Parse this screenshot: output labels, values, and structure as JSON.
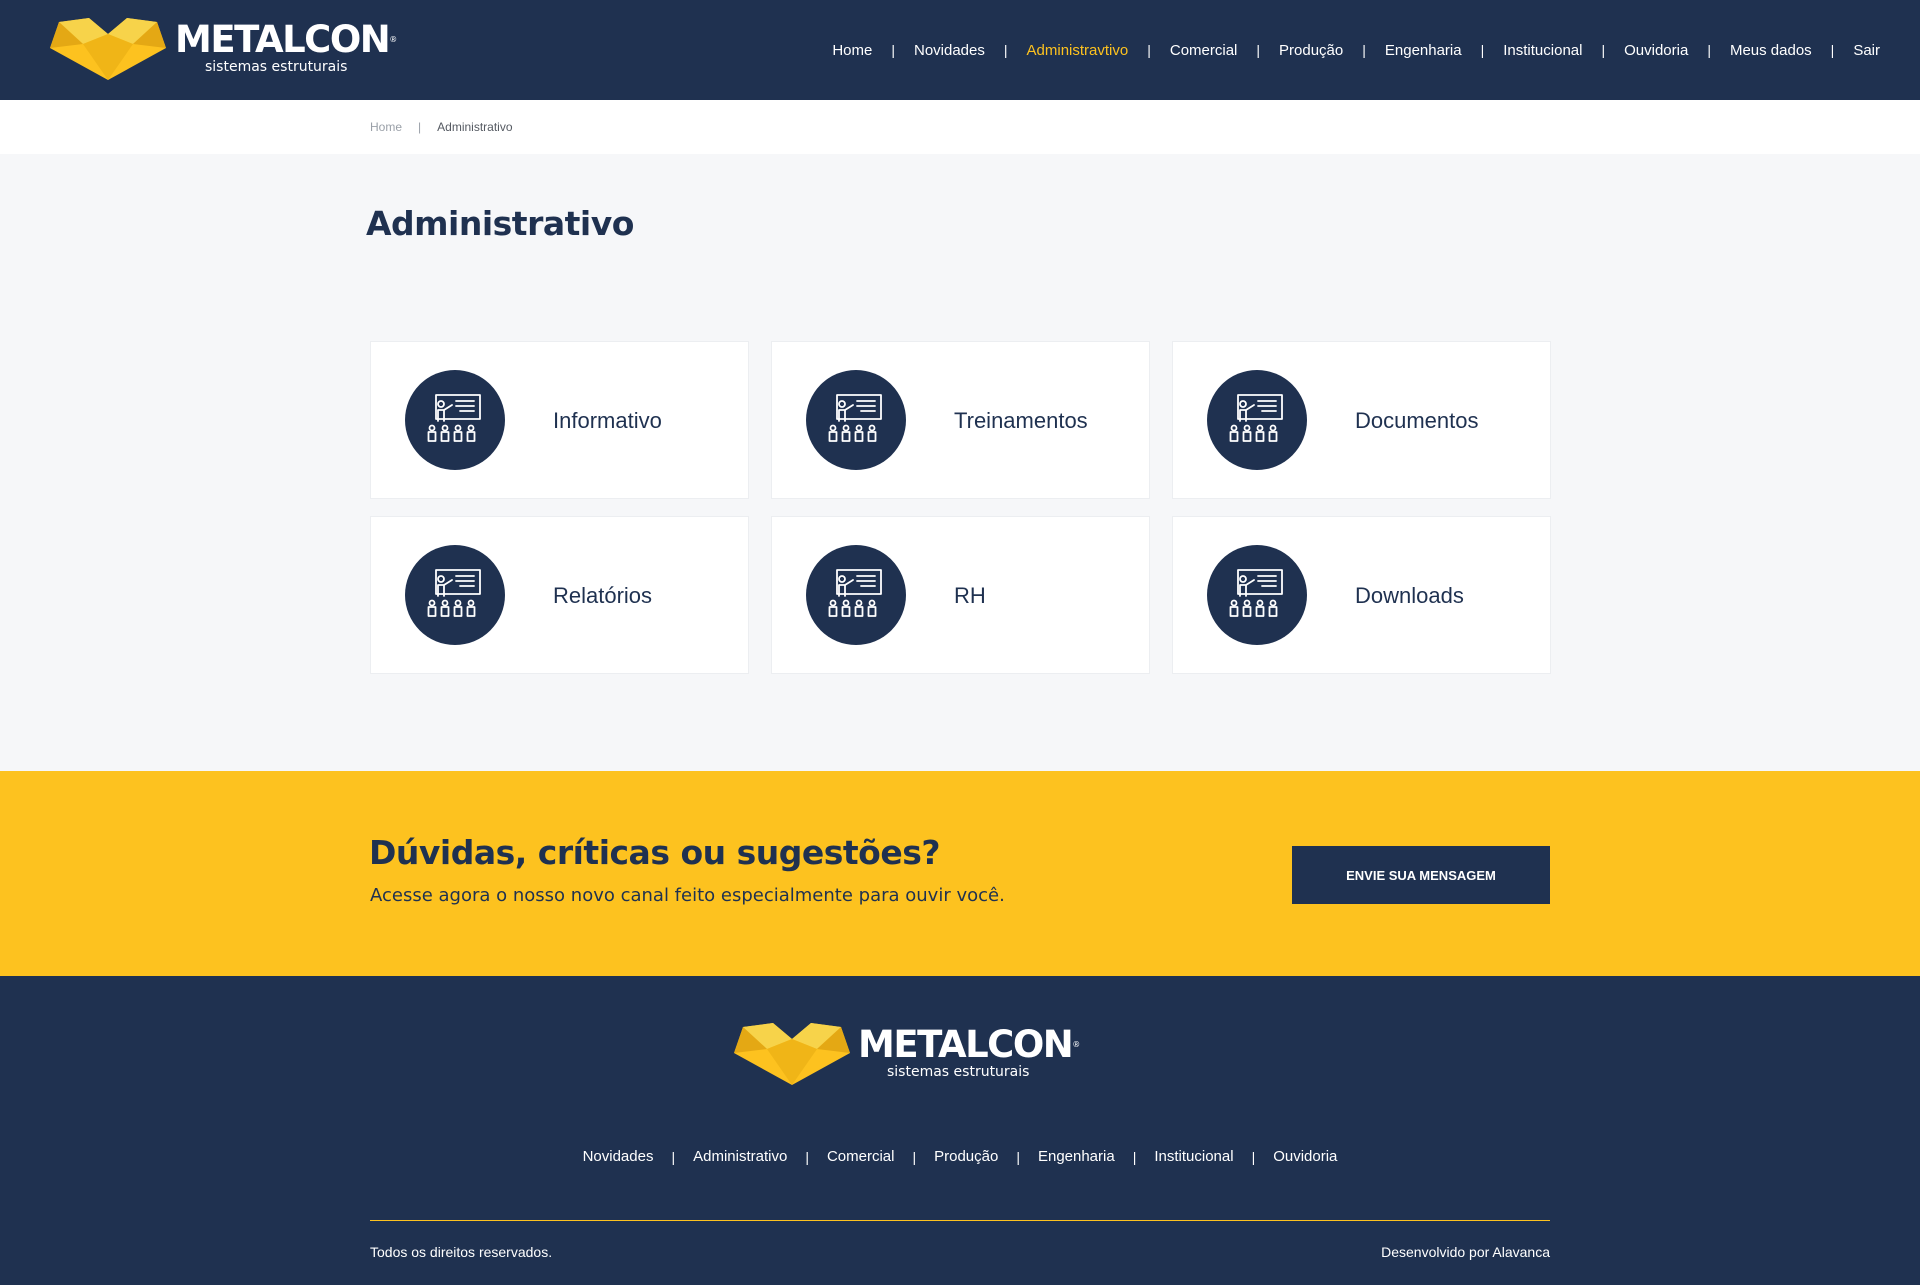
{
  "brand": {
    "name": "METALCON",
    "registered": "®",
    "tagline": "sistemas estruturais",
    "colors": {
      "navy": "#1f3150",
      "yellow": "#fdc21f",
      "light_bg": "#f6f7f9"
    }
  },
  "topnav": {
    "items": [
      {
        "label": "Home"
      },
      {
        "label": "Novidades"
      },
      {
        "label": "Administravtivo",
        "active": true
      },
      {
        "label": "Comercial"
      },
      {
        "label": "Produção"
      },
      {
        "label": "Engenharia"
      },
      {
        "label": "Institucional"
      },
      {
        "label": "Ouvidoria"
      },
      {
        "label": "Meus dados"
      },
      {
        "label": "Sair"
      }
    ],
    "separator": "|"
  },
  "breadcrumb": {
    "home": "Home",
    "separator": "|",
    "current": "Administrativo"
  },
  "page": {
    "title": "Administrativo"
  },
  "cards": [
    {
      "label": "Informativo",
      "icon": "presentation-icon"
    },
    {
      "label": "Treinamentos",
      "icon": "presentation-icon"
    },
    {
      "label": "Documentos",
      "icon": "presentation-icon"
    },
    {
      "label": "Relatórios",
      "icon": "presentation-icon"
    },
    {
      "label": "RH",
      "icon": "presentation-icon"
    },
    {
      "label": "Downloads",
      "icon": "presentation-icon"
    }
  ],
  "cta": {
    "title": "Dúvidas, críticas ou sugestões?",
    "text": "Acesse agora o nosso novo canal feito especialmente para ouvir você.",
    "button": "ENVIE SUA MENSAGEM"
  },
  "footer": {
    "nav": [
      "Novidades",
      "Administrativo",
      "Comercial",
      "Produção",
      "Engenharia",
      "Institucional",
      "Ouvidoria"
    ],
    "separator": "|",
    "copyright": "Todos os direitos reservados.",
    "developer": "Desenvolvido por Alavanca"
  }
}
